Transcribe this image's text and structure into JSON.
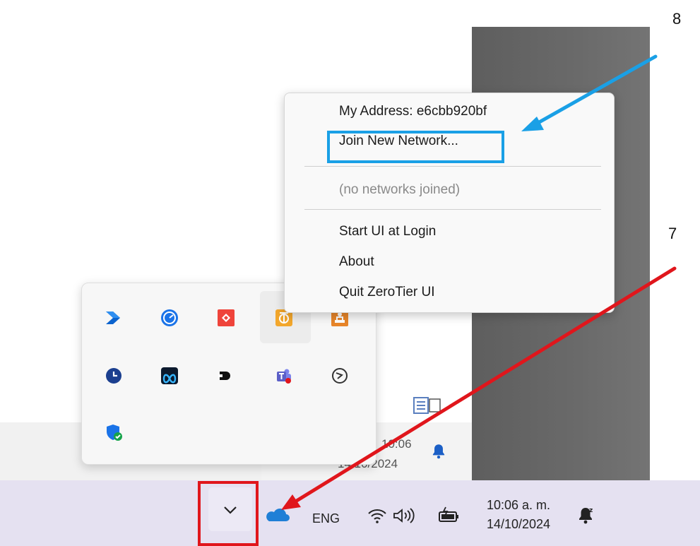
{
  "annotations": {
    "step_8": "8",
    "step_7": "7"
  },
  "menu": {
    "my_address": "My Address:  e6cbb920bf",
    "join_network": "Join New Network...",
    "no_networks": "(no networks joined)",
    "start_ui": "Start UI at Login",
    "about": "About",
    "quit": "Quit ZeroTier UI"
  },
  "tray_icons": [
    {
      "name": "power-automate-icon",
      "color": "#0b63ce"
    },
    {
      "name": "speed-dial-icon",
      "color": "#1a73e8"
    },
    {
      "name": "anydesk-icon",
      "color": "#ef443b"
    },
    {
      "name": "zerotier-icon",
      "color": "#f3a72c"
    },
    {
      "name": "stamp-app-icon",
      "color": "#e8862a"
    },
    {
      "name": "clock-app-icon",
      "color": "#1b3f8f"
    },
    {
      "name": "meta-app-icon",
      "color": "#2196f3"
    },
    {
      "name": "d-app-icon",
      "color": "#111111"
    },
    {
      "name": "teams-icon",
      "color": "#5b5fc7"
    },
    {
      "name": "app-switch-icon",
      "color": "#333333"
    },
    {
      "name": "windows-security-icon",
      "color": "#1a73e8"
    }
  ],
  "inner_clock": {
    "time": "10:06",
    "date": "14/10/2024"
  },
  "taskbar": {
    "language": "ENG",
    "time": "10:06 a. m.",
    "date": "14/10/2024"
  },
  "colors": {
    "highlight_blue": "#1aa0e6",
    "highlight_red": "#e0161c",
    "onedrive": "#1f7fd6"
  }
}
